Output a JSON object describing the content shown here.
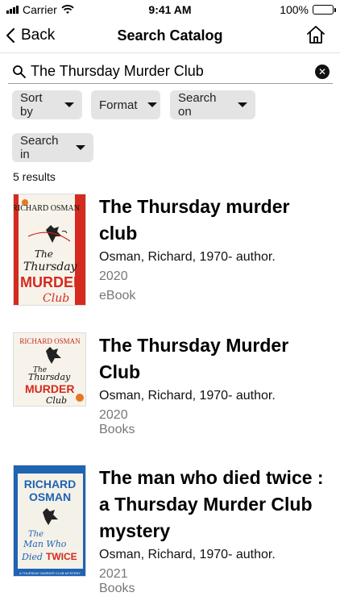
{
  "status_bar": {
    "carrier": "Carrier",
    "time": "9:41 AM",
    "battery": "100%"
  },
  "nav": {
    "back_label": "Back",
    "title": "Search Catalog"
  },
  "search": {
    "value": "The Thursday Murder Club"
  },
  "filters": [
    {
      "label": "Sort by"
    },
    {
      "label": "Format"
    },
    {
      "label": "Search on"
    },
    {
      "label": "Search in"
    }
  ],
  "results_count": "5 results",
  "results": [
    {
      "title": "The Thursday murder club",
      "author": "Osman, Richard, 1970- author.",
      "year": "2020",
      "format": "eBook",
      "cover": {
        "author": "RICHARD OSMAN",
        "line1": "The",
        "line2": "Thursday",
        "line3": "MURDER",
        "line4": "Club"
      }
    },
    {
      "title": "The Thursday Murder Club",
      "author": "Osman, Richard, 1970- author.",
      "year": "2020",
      "format": "Books",
      "cover": {
        "author": "RICHARD OSMAN",
        "line1": "The",
        "line2": "Thursday",
        "line3": "MURDER",
        "line4": "Club"
      }
    },
    {
      "title": "The man who died twice : a Thursday Murder Club mystery",
      "author": "Osman, Richard, 1970- author.",
      "year": "2021",
      "format": "Books",
      "cover": {
        "author1": "RICHARD",
        "author2": "OSMAN",
        "line1": "The",
        "line2": "Man Who",
        "line3": "Died",
        "line4": "TWICE",
        "footer": "A THURSDAY MURDER CLUB MYSTERY"
      }
    }
  ],
  "colors": {
    "chip_bg": "#e4e4e4",
    "cover1_bg": "#f7f3ea",
    "cover_red": "#d42a1f",
    "cover3_bg": "#1f63b3"
  }
}
